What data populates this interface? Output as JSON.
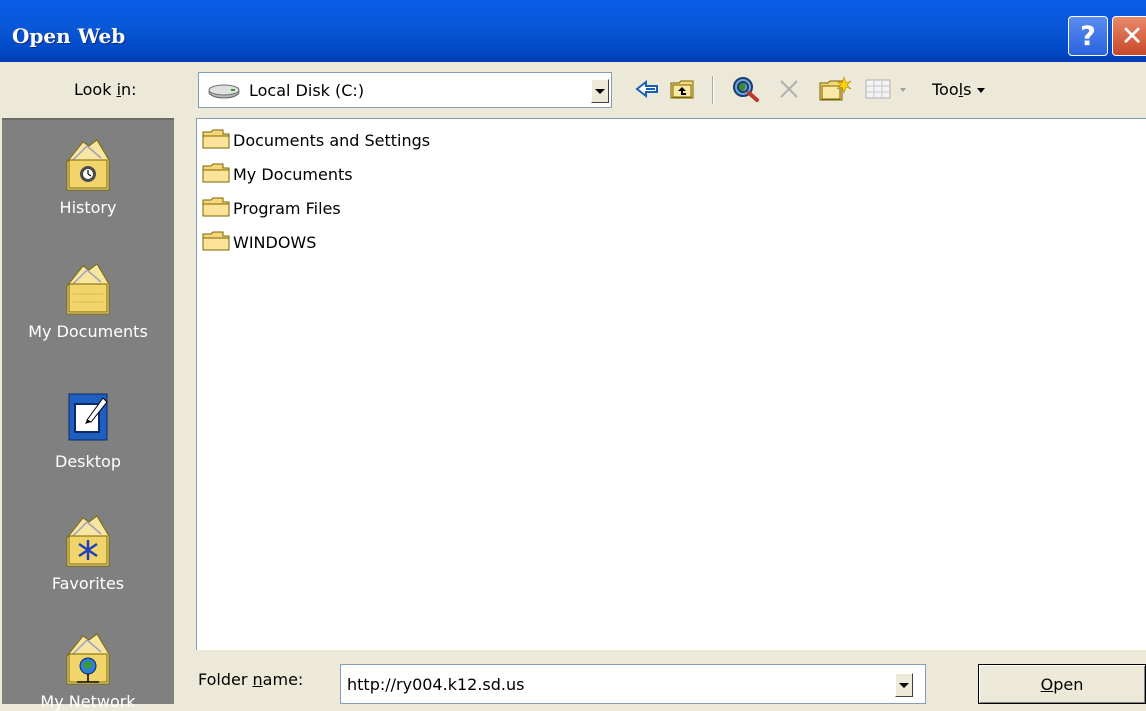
{
  "window": {
    "title": "Open Web",
    "help_label": "?",
    "close_label": "✕"
  },
  "toolbar": {
    "look_in_label_pre": "Look ",
    "look_in_label_hot": "i",
    "look_in_label_post": "n:",
    "look_in_value": "Local Disk (C:)",
    "tools_label_pre": "Too",
    "tools_label_hot": "l",
    "tools_label_post": "s",
    "icons": [
      "back-arrow-icon",
      "up-one-level-icon",
      "search-the-web-icon",
      "delete-icon",
      "create-new-folder-icon",
      "views-icon"
    ]
  },
  "places": [
    {
      "label": "History",
      "icon": "history-icon"
    },
    {
      "label": "My Documents",
      "icon": "my-documents-icon"
    },
    {
      "label": "Desktop",
      "icon": "desktop-icon"
    },
    {
      "label": "Favorites",
      "icon": "favorites-icon"
    },
    {
      "label": "My Network",
      "icon": "my-network-icon"
    }
  ],
  "files": [
    {
      "name": "Documents and Settings"
    },
    {
      "name": "My Documents"
    },
    {
      "name": "Program Files"
    },
    {
      "name": "WINDOWS"
    }
  ],
  "footer": {
    "folder_label_pre": "Folder ",
    "folder_label_hot": "n",
    "folder_label_post": "ame:",
    "folder_value": "http://ry004.k12.sd.us",
    "open_hot": "O",
    "open_post": "pen"
  },
  "colors": {
    "title_bar": "#0a57d6",
    "places_bar": "#808080",
    "dialog_bg": "#ece9d8"
  }
}
